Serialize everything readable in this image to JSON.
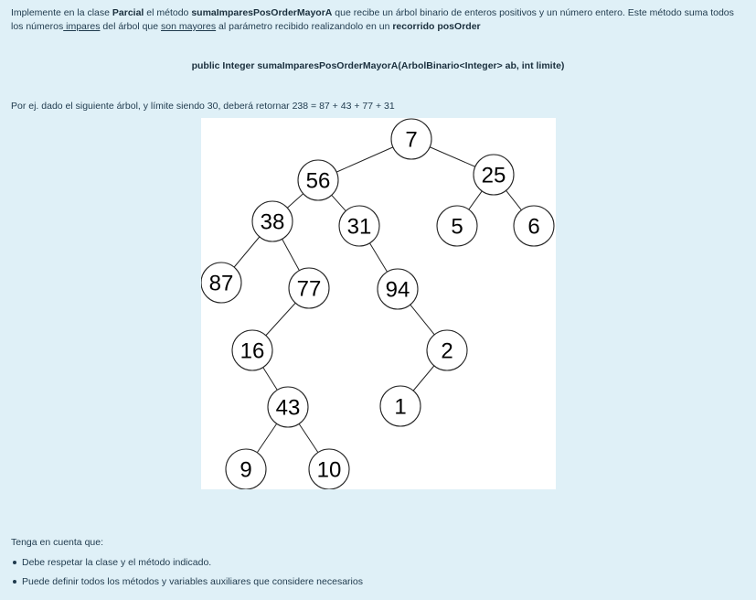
{
  "intro": {
    "t1": "Implemente en la clase ",
    "class_name": "Parcial",
    "t2": " el método ",
    "method_name": "sumaImparesPosOrderMayorA",
    "t3": " que recibe un árbol binario de enteros positivos y un número entero. Este método suma todos los números",
    "impares": " impares",
    "t4": " del árbol que ",
    "son_mayores": "son mayores",
    "t5": " al parámetro recibido realizandolo en un ",
    "recorrido": "recorrido posOrder"
  },
  "signature": "public Integer sumaImparesPosOrderMayorA(ArbolBinario<Integer> ab, int limite)",
  "example": "Por ej. dado el siguiente árbol, y límite siendo 30, deberá retornar 238 = 87 + 43 + 77 + 31",
  "tree": {
    "nodes": [
      {
        "id": "n7",
        "label": "7"
      },
      {
        "id": "n56",
        "label": "56"
      },
      {
        "id": "n25",
        "label": "25"
      },
      {
        "id": "n38",
        "label": "38"
      },
      {
        "id": "n31",
        "label": "31"
      },
      {
        "id": "n5",
        "label": "5"
      },
      {
        "id": "n6",
        "label": "6"
      },
      {
        "id": "n87",
        "label": "87"
      },
      {
        "id": "n77",
        "label": "77"
      },
      {
        "id": "n94",
        "label": "94"
      },
      {
        "id": "n16",
        "label": "16"
      },
      {
        "id": "n2",
        "label": "2"
      },
      {
        "id": "n43",
        "label": "43"
      },
      {
        "id": "n1",
        "label": "1"
      },
      {
        "id": "n9",
        "label": "9"
      },
      {
        "id": "n10",
        "label": "10"
      }
    ],
    "edges": [
      [
        "n7",
        "n56"
      ],
      [
        "n7",
        "n25"
      ],
      [
        "n56",
        "n38"
      ],
      [
        "n56",
        "n31"
      ],
      [
        "n25",
        "n5"
      ],
      [
        "n25",
        "n6"
      ],
      [
        "n38",
        "n87"
      ],
      [
        "n38",
        "n77"
      ],
      [
        "n31",
        "n94"
      ],
      [
        "n77",
        "n16"
      ],
      [
        "n94",
        "n2"
      ],
      [
        "n16",
        "n43"
      ],
      [
        "n2",
        "n1"
      ],
      [
        "n43",
        "n9"
      ],
      [
        "n43",
        "n10"
      ]
    ]
  },
  "notes": {
    "title": "Tenga en cuenta que:",
    "items": [
      "Debe respetar la clase y el método indicado.",
      "Puede definir todos los métodos y variables auxiliares que considere necesarios"
    ]
  }
}
